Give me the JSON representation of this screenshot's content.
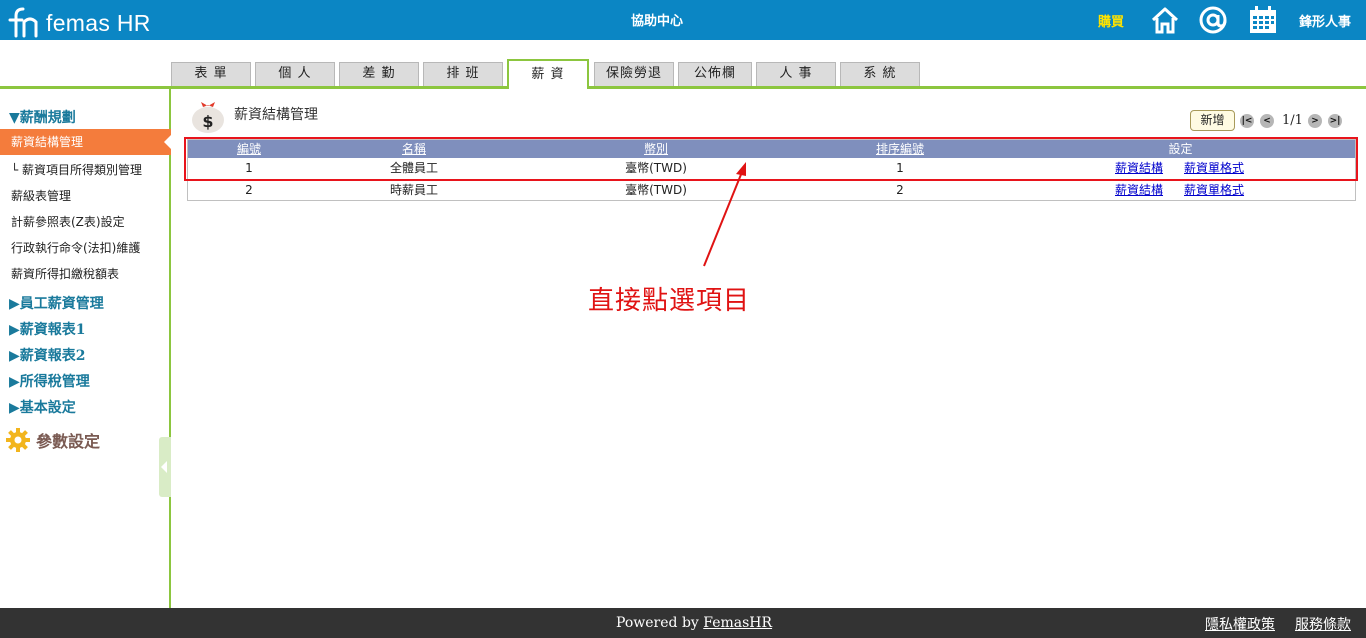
{
  "header": {
    "logo_text": "femas HR",
    "help_center": "協助中心",
    "buy": "購買",
    "company": "鋒形人事",
    "icons": [
      "home-icon",
      "at-icon",
      "calendar-icon"
    ]
  },
  "tabs": [
    {
      "label": "表  單",
      "active": false
    },
    {
      "label": "個  人",
      "active": false
    },
    {
      "label": "差  勤",
      "active": false
    },
    {
      "label": "排  班",
      "active": false
    },
    {
      "label": "薪  資",
      "active": true
    },
    {
      "label": "保險勞退",
      "active": false
    },
    {
      "label": "公佈欄",
      "active": false
    },
    {
      "label": "人  事",
      "active": false
    },
    {
      "label": "系  統",
      "active": false
    }
  ],
  "sidebar": {
    "section_expanded": "▼薪酬規劃",
    "active_item": "薪資結構管理",
    "items": [
      "└ 薪資項目所得類別管理",
      "薪級表管理",
      "計薪參照表(Z表)設定",
      "行政執行命令(法扣)維護",
      "薪資所得扣繳稅額表"
    ],
    "groups": [
      "▶員工薪資管理",
      "▶薪資報表1",
      "▶薪資報表2",
      "▶所得稅管理",
      "▶基本設定"
    ],
    "param_settings": "參數設定"
  },
  "main": {
    "title": "薪資結構管理",
    "add_button": "新增",
    "pager": {
      "first": "|<",
      "prev": "<",
      "text": "1/1",
      "next": ">",
      "last": ">|"
    },
    "columns": [
      "編號",
      "名稱",
      "幣別",
      "排序編號",
      "設定"
    ],
    "rows": [
      {
        "no": "1",
        "name": "全體員工",
        "currency": "臺幣(TWD)",
        "sort": "1",
        "link1": "薪資結構",
        "link2": "薪資單格式"
      },
      {
        "no": "2",
        "name": "時薪員工",
        "currency": "臺幣(TWD)",
        "sort": "2",
        "link1": "薪資結構",
        "link2": "薪資單格式"
      }
    ]
  },
  "annotation": {
    "text": "直接點選項目",
    "color": "#e01313"
  },
  "footer": {
    "powered_prefix": "Powered by ",
    "powered_link": "FemasHR",
    "privacy": "隱私權政策",
    "terms": "服務條款"
  },
  "colors": {
    "header_bg": "#0b86c4",
    "accent_green": "#8cc63f",
    "active_orange": "#f47c3c",
    "grid_header": "#7f8fbd"
  }
}
